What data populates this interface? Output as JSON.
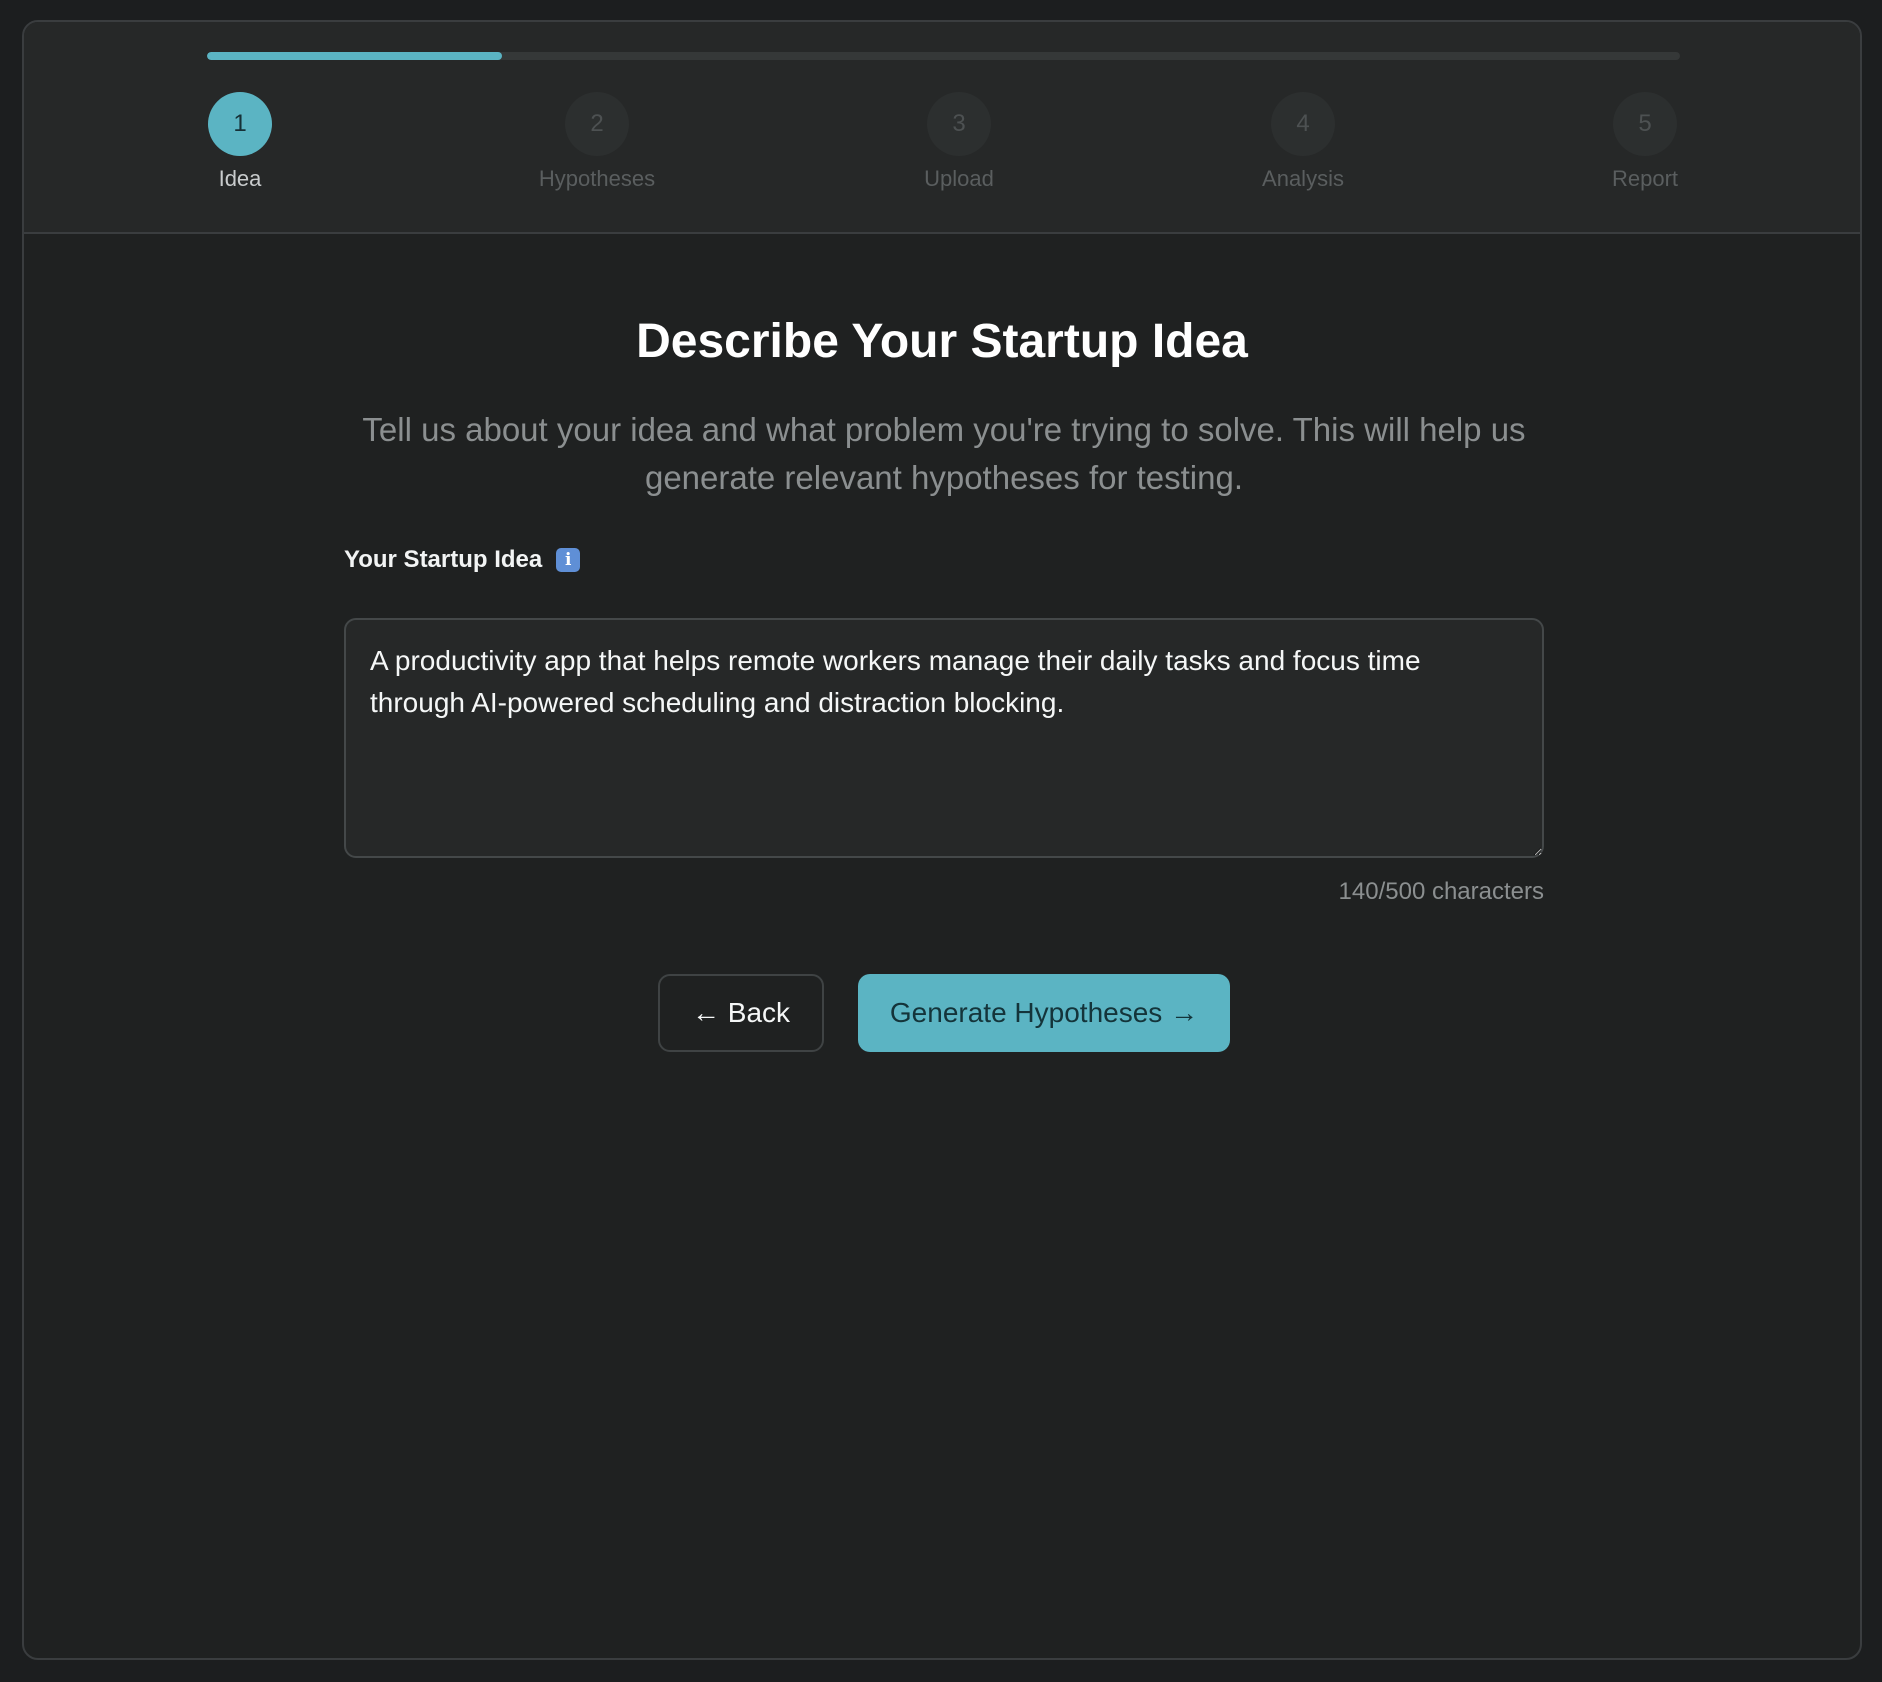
{
  "progress": {
    "fraction": 0.2
  },
  "steps": [
    {
      "number": "1",
      "label": "Idea",
      "active": true
    },
    {
      "number": "2",
      "label": "Hypotheses",
      "active": false
    },
    {
      "number": "3",
      "label": "Upload",
      "active": false
    },
    {
      "number": "4",
      "label": "Analysis",
      "active": false
    },
    {
      "number": "5",
      "label": "Report",
      "active": false
    }
  ],
  "main": {
    "title": "Describe Your Startup Idea",
    "subtitle": "Tell us about your idea and what problem you're trying to solve. This will help us generate relevant hypotheses for testing.",
    "field_label": "Your Startup Idea",
    "info_icon": "info-icon",
    "field_value": "A productivity app that helps remote workers manage their daily tasks and focus time through AI-powered scheduling and distraction blocking.",
    "char_count": "140/500 characters"
  },
  "actions": {
    "back_label": "← Back",
    "generate_label": "Generate Hypotheses →"
  },
  "colors": {
    "accent": "#5bb4c3",
    "background": "#1f2121",
    "panel": "#262828"
  }
}
